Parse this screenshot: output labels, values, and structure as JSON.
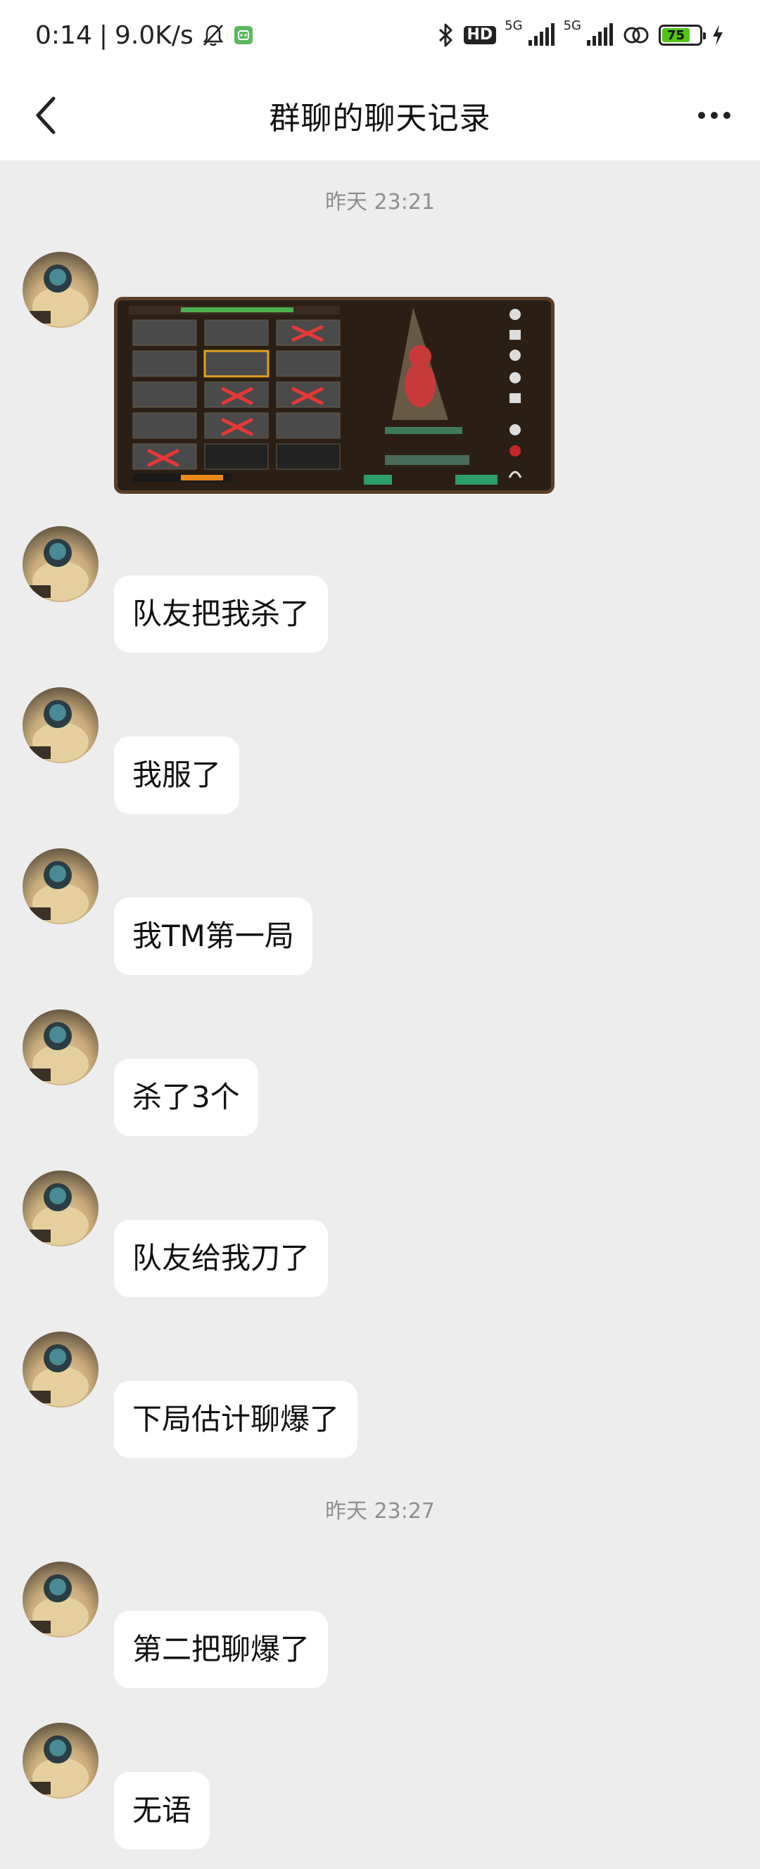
{
  "status_bar": {
    "time": "0:14",
    "separator": "|",
    "network_speed": "9.0K/s",
    "hd_label": "HD",
    "net1": "5G",
    "net2": "5G",
    "battery": "75",
    "battery_level": 0.75,
    "battery_color": "#52c41a",
    "icons": [
      "mute-bell-icon",
      "app-notification-icon",
      "bluetooth-icon",
      "signal-icon",
      "signal-icon",
      "link-icon",
      "charging-icon"
    ]
  },
  "nav": {
    "title": "群聊的聊天记录",
    "back_icon": "chevron-left-icon",
    "more_icon": "more-dots-icon"
  },
  "chat": {
    "time_1": "昨天 23:21",
    "time_2": "昨天 23:27",
    "messages": [
      {
        "type": "image",
        "alt": "game screenshot"
      },
      {
        "type": "text",
        "text": "队友把我杀了"
      },
      {
        "type": "text",
        "text": "我服了"
      },
      {
        "type": "text",
        "text": "我TM第一局"
      },
      {
        "type": "text",
        "text": "杀了3个"
      },
      {
        "type": "text",
        "text": "队友给我刀了"
      },
      {
        "type": "text",
        "text": "下局估计聊爆了"
      },
      {
        "type": "text",
        "text": "第二把聊爆了"
      },
      {
        "type": "text",
        "text": "无语"
      }
    ]
  }
}
